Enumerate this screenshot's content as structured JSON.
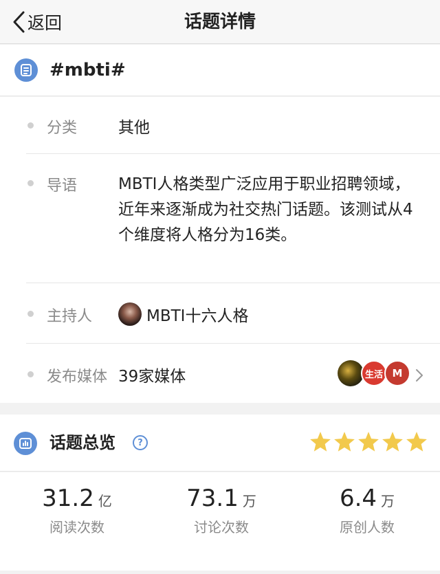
{
  "nav": {
    "back_label": "返回",
    "title": "话题详情"
  },
  "topic": {
    "name": "#mbti#"
  },
  "details": {
    "category": {
      "label": "分类",
      "value": "其他"
    },
    "intro": {
      "label": "导语",
      "value": "MBTI人格类型广泛应用于职业招聘领域，近年来逐渐成为社交热门话题。该测试从4个维度将人格分为16类。"
    },
    "host": {
      "label": "主持人",
      "value": "MBTI十六人格"
    },
    "media": {
      "label": "发布媒体",
      "value": "39家媒体",
      "badge_2_text": "生活",
      "badge_3_text": "M"
    }
  },
  "overview": {
    "title": "话题总览",
    "help_text": "?",
    "rating_stars": 5,
    "star_color": "#f2c94c",
    "stats": [
      {
        "value": "31.2",
        "unit": "亿",
        "label": "阅读次数"
      },
      {
        "value": "73.1",
        "unit": "万",
        "label": "讨论次数"
      },
      {
        "value": "6.4",
        "unit": "万",
        "label": "原创人数"
      }
    ]
  },
  "colors": {
    "accent": "#5e8fd6",
    "background": "#f2f2f2",
    "text": "#222222",
    "secondary_text": "#8a8a8a"
  }
}
